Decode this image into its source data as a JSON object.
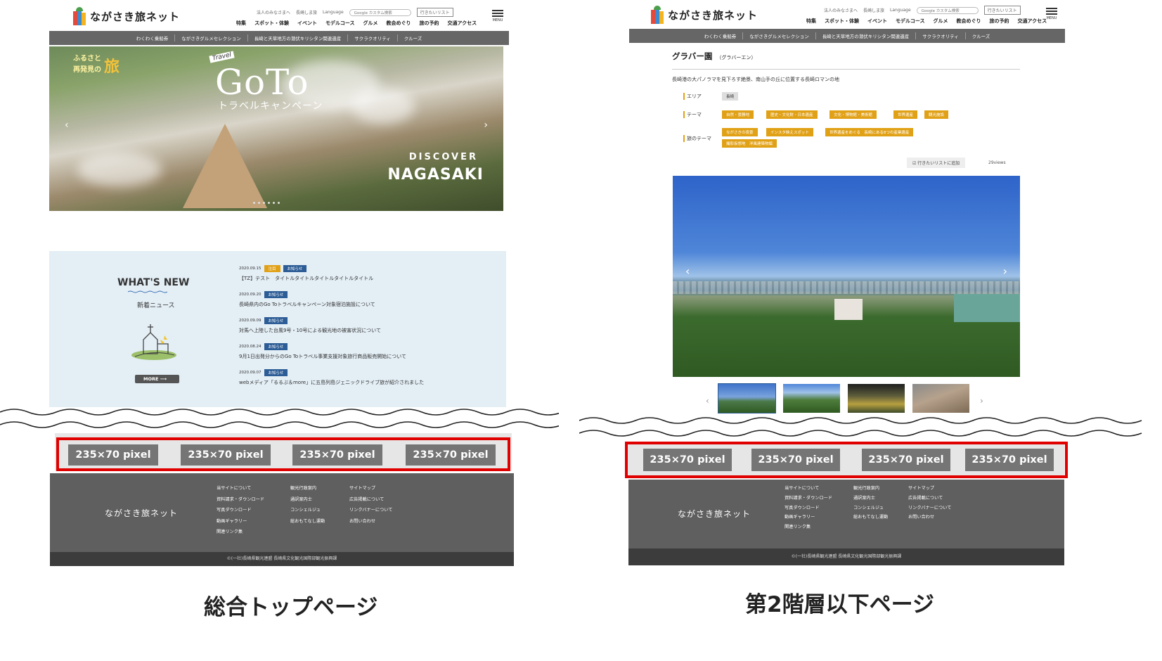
{
  "site": {
    "logo_text": "ながさき旅ネット",
    "util": {
      "corporate_link": "法人のみなさまへ",
      "nagasaki_link": "長崎しま旅",
      "language": "Language",
      "search_placeholder": "Google カスタム検索",
      "wishlist": "行きたいリスト"
    },
    "gnav": [
      "特集",
      "スポット・体験",
      "イベント",
      "モデルコース",
      "グルメ",
      "教会めぐり",
      "旅の予約",
      "交通アクセス"
    ],
    "menu_label": "MENU",
    "categories": [
      "わくわく乗船券",
      "ながさきグルメセレクション",
      "長崎と天草地方の潜伏キリシタン関連遺産",
      "サクラクオリティ",
      "クルーズ"
    ]
  },
  "hero": {
    "tag_line1": "ふるさと",
    "tag_line2": "再発見の",
    "tag_big": "旅",
    "travel": "Travel",
    "goto": "GoTo",
    "campaign": "トラベルキャンペーン",
    "discover": "DISCOVER",
    "nagasaki": "NAGASAKI"
  },
  "news": {
    "title": "WHAT'S NEW",
    "subtitle": "新着ニュース",
    "more": "MORE",
    "items": [
      {
        "date": "2020.09.15",
        "badges": [
          "注目",
          "お知らせ"
        ],
        "text": "【TZ】テスト　タイトルタイトルタイトルタイトルタイトル"
      },
      {
        "date": "2020.09.20",
        "badges": [
          "お知らせ"
        ],
        "text": "長崎県内のGo Toトラベルキャンペーン対象宿泊施設について"
      },
      {
        "date": "2020.09.09",
        "badges": [
          "お知らせ"
        ],
        "text": "対馬へ上陸した台風9号・10号による観光地の被害状況について"
      },
      {
        "date": "2020.08.24",
        "badges": [
          "お知らせ"
        ],
        "text": "9月1日出発分からのGo Toトラベル事業支援対象旅行商品販売開始について"
      },
      {
        "date": "2020.09.07",
        "badges": [
          "お知らせ"
        ],
        "text": "webメディア「るるぶ＆more」に五島列島ジェニックドライブ旅が紹介されました"
      }
    ]
  },
  "banners": {
    "label": "235×70 pixel",
    "top_count": 4,
    "detail_count": 4
  },
  "footer": {
    "logo": "ながさき旅ネット",
    "col1": [
      "当サイトについて",
      "資料請求・ダウンロード",
      "写真ダウンロード",
      "動画ギャラリー",
      "関連リンク集"
    ],
    "col2": [
      "観光行政案内",
      "通訳案内士",
      "コンシェルジュ",
      "総おもてなし運動"
    ],
    "col3": [
      "サイトマップ",
      "広告掲載について",
      "リンクバナーについて",
      "お問い合わせ"
    ],
    "copyright": "©(一社)長崎県観光連盟 長崎県文化観光国際部観光振興課"
  },
  "detail": {
    "title": "グラバー園",
    "reading": "（グラバーエン）",
    "lead": "長崎港の大パノラマを見下ろす絶景、南山手の丘に位置する長崎ロマンの地",
    "area_label": "エリア",
    "area": "長崎",
    "theme_label": "テーマ",
    "themes": [
      "自然・景勝地",
      "歴史・文化財・日本遺産",
      "文化・博物館・美術館",
      "世界遺産",
      "観光施設"
    ],
    "trip_theme_label": "旅のテーマ",
    "trip_themes": [
      "ながさきの夜景",
      "インスタ映えスポット",
      "世界遺産をめぐる　長崎にある8つの産業遺産",
      "撮影仮想地　洋風建築物編"
    ],
    "wishlist_btn": "行きたいリストに追加",
    "views": "29views"
  },
  "captions": {
    "top": "総合トップページ",
    "detail": "第2階層以下ページ"
  },
  "colors": {
    "accent_red": "#e00000",
    "badge_orange": "#e1a117",
    "badge_blue": "#2d5d96",
    "footer_gray": "#5f5f5f",
    "nav_gray": "#666666"
  }
}
